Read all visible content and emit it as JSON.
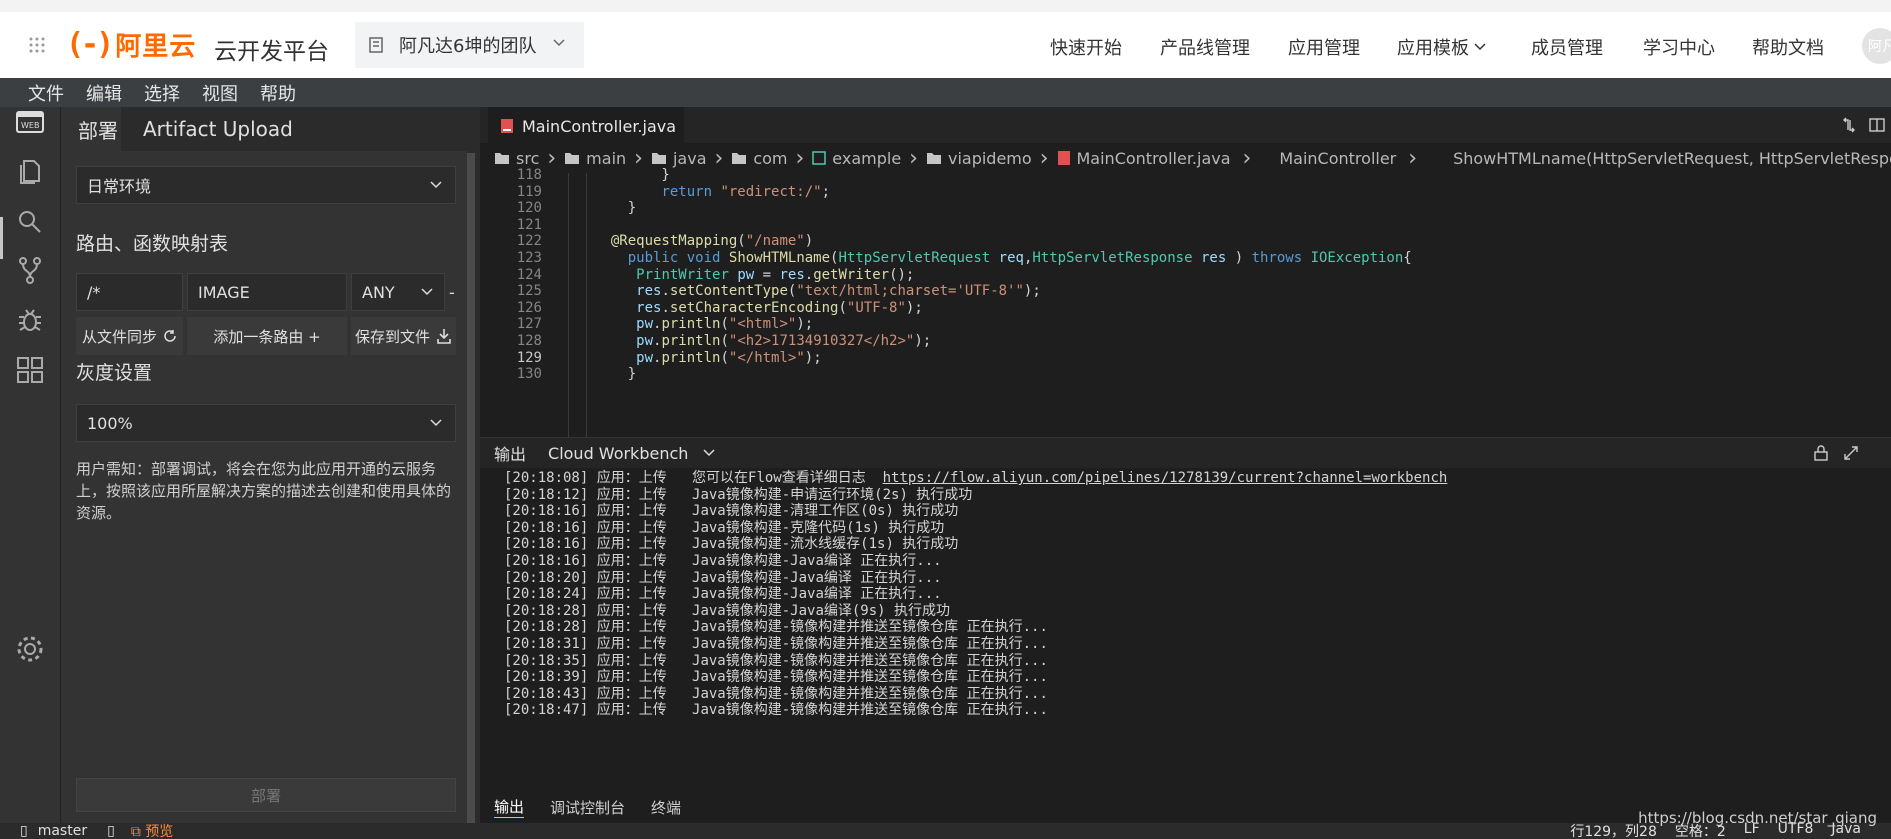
{
  "header": {
    "brand_mark": "(-)",
    "brand": "阿里云",
    "platform": "云开发平台",
    "team": "阿凡达6坤的团队",
    "nav": [
      "快速开始",
      "产品线管理",
      "应用管理",
      "应用模板",
      "成员管理",
      "学习中心",
      "帮助文档"
    ],
    "avatar_text": "阿凡"
  },
  "menubar": [
    "文件",
    "编辑",
    "选择",
    "视图",
    "帮助"
  ],
  "side": {
    "tabs": [
      "部署",
      "Artifact Upload"
    ],
    "env_select": "日常环境",
    "route_title": "路由、函数映射表",
    "route": {
      "path": "/*",
      "type": "IMAGE",
      "method": "ANY",
      "extra": "-"
    },
    "buttons": {
      "sync": "从文件同步",
      "add": "添加一条路由 +",
      "save": "保存到文件"
    },
    "gray_title": "灰度设置",
    "gray_select": "100%",
    "note": "用户需知：部署调试，将会在您为此应用开通的云服务上，按照该应用所屋解决方案的描述去创建和使用具体的资源。",
    "deploy": "部署"
  },
  "editor": {
    "tab": "MainController.java",
    "breadcrumb": [
      "src",
      "main",
      "java",
      "com",
      "example",
      "viapidemo",
      "MainController.java",
      "MainController",
      "ShowHTMLname(HttpServletRequest, HttpServletResponse)"
    ],
    "lines": [
      {
        "n": "118",
        "t": "        }"
      },
      {
        "n": "119",
        "t": "        return \"redirect:/\";"
      },
      {
        "n": "120",
        "t": "    }"
      },
      {
        "n": "121",
        "t": ""
      },
      {
        "n": "122",
        "t": "  @RequestMapping(\"/name\")"
      },
      {
        "n": "123",
        "t": "    public void ShowHTMLname(HttpServletRequest req,HttpServletResponse res ) throws IOException{"
      },
      {
        "n": "124",
        "t": "     PrintWriter pw = res.getWriter();"
      },
      {
        "n": "125",
        "t": "     res.setContentType(\"text/html;charset='UTF-8'\");"
      },
      {
        "n": "126",
        "t": "     res.setCharacterEncoding(\"UTF-8\");"
      },
      {
        "n": "127",
        "t": "     pw.println(\"<html>\");"
      },
      {
        "n": "128",
        "t": "     pw.println(\"<h2>17134910327</h2>\");"
      },
      {
        "n": "129",
        "t": "     pw.println(\"</html>\");"
      },
      {
        "n": "130",
        "t": "    }"
      }
    ]
  },
  "panel": {
    "tab_output": "输出",
    "channel": "Cloud Workbench",
    "logs": [
      {
        "time": "[20:18:08]",
        "src": "应用：上传",
        "msg": "您可以在Flow查看详细日志",
        "link": "https://flow.aliyun.com/pipelines/1278139/current?channel=workbench"
      },
      {
        "time": "[20:18:12]",
        "src": "应用：上传",
        "msg": "Java镜像构建-申请运行环境(2s) 执行成功"
      },
      {
        "time": "[20:18:16]",
        "src": "应用：上传",
        "msg": "Java镜像构建-清理工作区(0s) 执行成功"
      },
      {
        "time": "[20:18:16]",
        "src": "应用：上传",
        "msg": "Java镜像构建-克隆代码(1s) 执行成功"
      },
      {
        "time": "[20:18:16]",
        "src": "应用：上传",
        "msg": "Java镜像构建-流水线缓存(1s) 执行成功"
      },
      {
        "time": "[20:18:16]",
        "src": "应用：上传",
        "msg": "Java镜像构建-Java编译 正在执行..."
      },
      {
        "time": "[20:18:20]",
        "src": "应用：上传",
        "msg": "Java镜像构建-Java编译 正在执行..."
      },
      {
        "time": "[20:18:24]",
        "src": "应用：上传",
        "msg": "Java镜像构建-Java编译 正在执行..."
      },
      {
        "time": "[20:18:28]",
        "src": "应用：上传",
        "msg": "Java镜像构建-Java编译(9s) 执行成功"
      },
      {
        "time": "[20:18:28]",
        "src": "应用：上传",
        "msg": "Java镜像构建-镜像构建并推送至镜像仓库 正在执行..."
      },
      {
        "time": "[20:18:31]",
        "src": "应用：上传",
        "msg": "Java镜像构建-镜像构建并推送至镜像仓库 正在执行..."
      },
      {
        "time": "[20:18:35]",
        "src": "应用：上传",
        "msg": "Java镜像构建-镜像构建并推送至镜像仓库 正在执行..."
      },
      {
        "time": "[20:18:39]",
        "src": "应用：上传",
        "msg": "Java镜像构建-镜像构建并推送至镜像仓库 正在执行..."
      },
      {
        "time": "[20:18:43]",
        "src": "应用：上传",
        "msg": "Java镜像构建-镜像构建并推送至镜像仓库 正在执行..."
      },
      {
        "time": "[20:18:47]",
        "src": "应用：上传",
        "msg": "Java镜像构建-镜像构建并推送至镜像仓库 正在执行..."
      }
    ],
    "bottom_tabs": [
      "输出",
      "调试控制台",
      "终端"
    ]
  },
  "status": {
    "branch": "master",
    "preview": "预览",
    "position": "行129，列28",
    "spaces": "空格：2",
    "eol": "LF",
    "encoding": "UTF8",
    "language": "Java"
  },
  "watermark": "https://blog.csdn.net/star_qiang",
  "colors": {
    "brand": "#ff6a00",
    "bg_dark": "#1e1e1e",
    "panel": "#333333"
  }
}
